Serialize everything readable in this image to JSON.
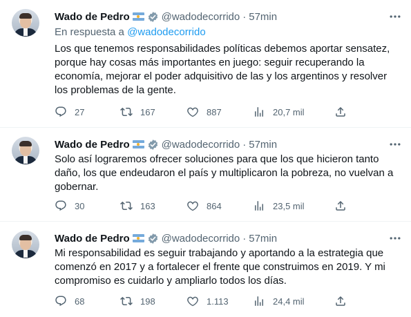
{
  "colors": {
    "link": "#1d9bf0",
    "muted": "#536471",
    "text": "#0f1419",
    "separator": "#eff3f4"
  },
  "icons": {
    "verified": "verified-badge-icon",
    "flag": "argentina-flag-icon",
    "more": "more-dots-icon",
    "reply": "reply-icon",
    "retweet": "retweet-icon",
    "like": "heart-icon",
    "views": "views-chart-icon",
    "share": "share-icon"
  },
  "tweets": [
    {
      "name": "Wado de Pedro",
      "handle": "@wadodecorrido",
      "dot": "·",
      "time": "57min",
      "reply_prefix": "En respuesta a ",
      "reply_to": "@wadodecorrido",
      "text": "Los que tenemos responsabilidades políticas debemos aportar sensatez,\nporque hay cosas más importantes en juego: seguir recuperando la\neconomía, mejorar el poder adquisitivo de las y los argentinos y resolver\nlos problemas de la gente.",
      "replies": "27",
      "retweets": "167",
      "likes": "887",
      "views": "20,7 mil"
    },
    {
      "name": "Wado de Pedro",
      "handle": "@wadodecorrido",
      "dot": "·",
      "time": "57min",
      "text": "Solo así lograremos ofrecer soluciones para que los que hicieron tanto\ndaño, los que endeudaron el país y multiplicaron la pobreza, no vuelvan a\ngobernar.",
      "replies": "30",
      "retweets": "163",
      "likes": "864",
      "views": "23,5 mil"
    },
    {
      "name": "Wado de Pedro",
      "handle": "@wadodecorrido",
      "dot": "·",
      "time": "57min",
      "text": "Mi responsabilidad es seguir trabajando y aportando a la estrategia que\ncomenzó en 2017 y a fortalecer el frente que construimos en 2019. Y mi\ncompromiso es cuidarlo y ampliarlo todos los días.",
      "replies": "68",
      "retweets": "198",
      "likes": "1.113",
      "views": "24,4 mil"
    }
  ]
}
